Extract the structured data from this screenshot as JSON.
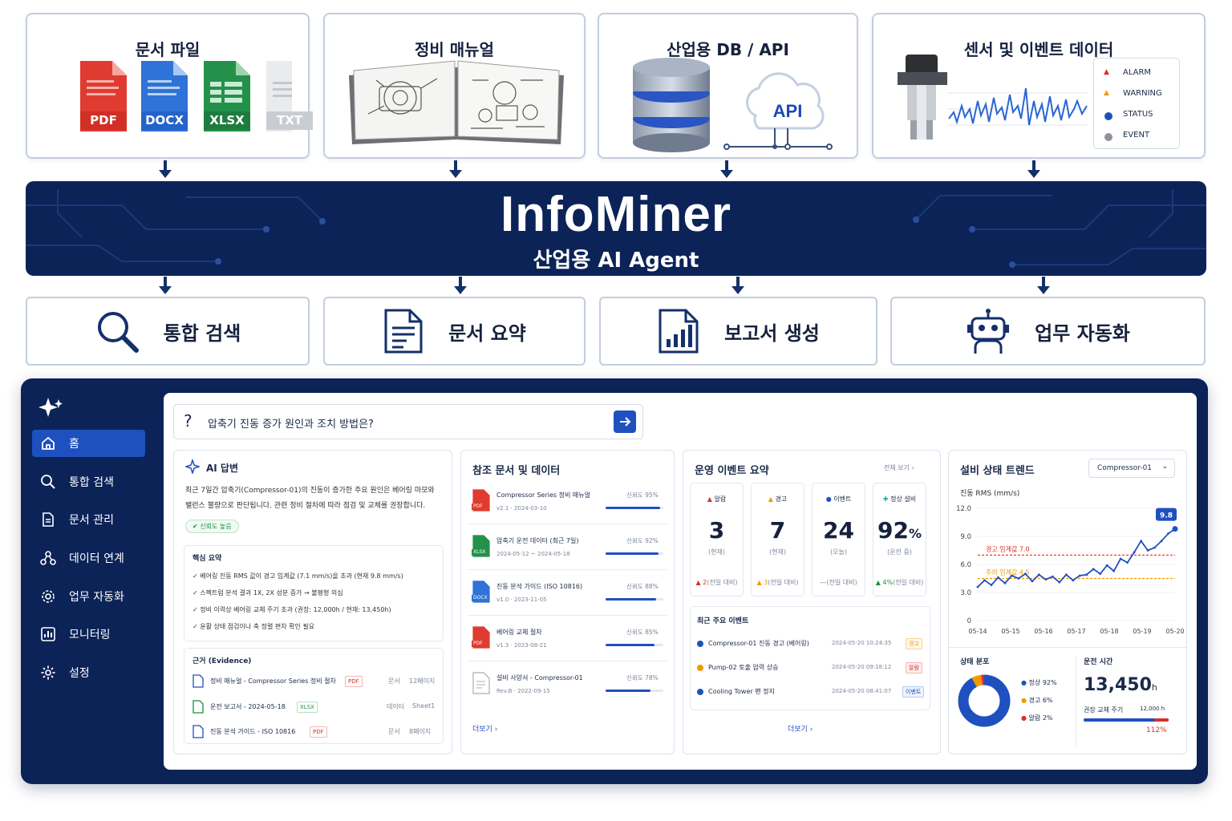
{
  "sources": [
    {
      "title": "문서 파일",
      "files": [
        "PDF",
        "DOCX",
        "XLSX",
        "TXT"
      ]
    },
    {
      "title": "정비 매뉴얼"
    },
    {
      "title": "산업용 DB / API",
      "api_label": "API"
    },
    {
      "title": "센서 및 이벤트 데이터",
      "legend": [
        "ALARM",
        "WARNING",
        "STATUS",
        "EVENT"
      ]
    }
  ],
  "banner": {
    "name": "InfoMiner",
    "subtitle": "산업용 AI Agent"
  },
  "capabilities": [
    {
      "label": "통합 검색",
      "icon": "magnifier-icon"
    },
    {
      "label": "문서 요약",
      "icon": "document-icon"
    },
    {
      "label": "보고서 생성",
      "icon": "report-chart-icon"
    },
    {
      "label": "업무 자동화",
      "icon": "robot-icon"
    }
  ],
  "colors": {
    "navy": "#0c2358",
    "blue": "#1f50c0",
    "red": "#d93025",
    "orange": "#f29900",
    "green": "#1e8e3e"
  },
  "app": {
    "nav": [
      "홈",
      "통합 검색",
      "문서 관리",
      "데이터 연계",
      "업무 자동화",
      "모니터링",
      "설정"
    ],
    "search": {
      "query": "압축기 진동 증가 원인과 조치 방법은?"
    },
    "answer": {
      "title": "AI 답변",
      "text1": "최근 7일간 압축기(Compressor-01)의 진동이 증가한 주요 원인은 베어링 마모와",
      "text2": "밸런스 불량으로 판단됩니다. 관련 정비 절차에 따라 점검 및 교체를 권장합니다.",
      "confidence": "신뢰도 높음",
      "summary_title": "핵심 요약",
      "summary": [
        "베어링 진동 RMS 값이 경고 임계값 (7.1 mm/s)을 초과 (현재 9.8 mm/s)",
        "스펙트럼 분석 결과 1X, 2X 성분 증가 → 불평형 의심",
        "정비 이력상 베어링 교체 주기 초과 (권장: 12,000h / 현재: 13,450h)",
        "윤활 상태 점검이나 축 정렬 편차 확인 필요"
      ],
      "evidence_title": "근거 (Evidence)",
      "evidence": [
        {
          "title": "정비 매뉴얼 - Compressor Series 정비 절차",
          "type": "PDF",
          "kind": "문서",
          "loc": "12페이지"
        },
        {
          "title": "운전 보고서 - 2024-05-18",
          "type": "XLSX",
          "kind": "데이터",
          "loc": "Sheet1"
        },
        {
          "title": "진동 분석 가이드 - ISO 10816",
          "type": "PDF",
          "kind": "문서",
          "loc": "8페이지"
        }
      ]
    },
    "refs": {
      "title": "참조 문서 및 데이터",
      "items": [
        {
          "name": "Compressor Series 정비 매뉴얼",
          "meta": "v2.1 · 2024-03-10",
          "conf": "신뢰도 95%",
          "value": 95,
          "type": "PDF"
        },
        {
          "name": "압축기 운전 데이터 (최근 7일)",
          "meta": "2024-05-12 ~ 2024-05-18",
          "conf": "신뢰도 92%",
          "value": 92,
          "type": "XLSX"
        },
        {
          "name": "진동 분석 가이드 (ISO 10816)",
          "meta": "v1.0 · 2023-11-05",
          "conf": "신뢰도 88%",
          "value": 88,
          "type": "DOCX"
        },
        {
          "name": "베어링 교체 절차",
          "meta": "v1.3 · 2023-08-21",
          "conf": "신뢰도 85%",
          "value": 85,
          "type": "PDF"
        },
        {
          "name": "설비 사양서 - Compressor-01",
          "meta": "Rev.B · 2022-09-15",
          "conf": "신뢰도 78%",
          "value": 78,
          "type": "TXT"
        }
      ],
      "more": "더보기"
    },
    "events": {
      "title": "운영 이벤트 요약",
      "view_all": "전체 보기",
      "stats": [
        {
          "label": "알람",
          "value": "3",
          "unit": "",
          "sub": "(현재)",
          "delta": "▲ 2",
          "delta_note": "(전일 대비)"
        },
        {
          "label": "경고",
          "value": "7",
          "unit": "",
          "sub": "(현재)",
          "delta": "▲ 3",
          "delta_note": "(전일 대비)"
        },
        {
          "label": "이벤트",
          "value": "24",
          "unit": "",
          "sub": "(오늘)",
          "delta": "—",
          "delta_note": "(전일 대비)"
        },
        {
          "label": "정상 설비",
          "value": "92",
          "unit": "%",
          "sub": "(운전 중)",
          "delta": "▲ 4%",
          "delta_note": "(전일 대비)"
        }
      ],
      "recent_title": "최근 주요 이벤트",
      "recent": [
        {
          "text": "Compressor-01 진동 경고 (베어링)",
          "time": "2024-05-20  10:24:35",
          "tag": "경고"
        },
        {
          "text": "Pump-02 토출 압력 상승",
          "time": "2024-05-20  09:18:12",
          "tag": "알람"
        },
        {
          "text": "Cooling Tower 팬 정지",
          "time": "2024-05-20  08:41:07",
          "tag": "이벤트"
        }
      ],
      "more": "더보기"
    },
    "trend": {
      "title": "설비 상태 트렌드",
      "equipment": "Compressor-01",
      "metric": "진동 RMS (mm/s)",
      "warn_label": "경고 임계값  7.0",
      "caution_label": "주의 임계값  4.5",
      "latest": "9.8",
      "dist_title": "상태 분포",
      "dist": [
        {
          "label": "정상",
          "pct": "92%",
          "value": 92
        },
        {
          "label": "경고",
          "pct": "6%",
          "value": 6
        },
        {
          "label": "알람",
          "pct": "2%",
          "value": 2
        }
      ],
      "runtime_title": "운전 시간",
      "runtime_value": "13,450",
      "runtime_unit": "h",
      "replace_label": "권장 교체 주기",
      "replace_value": "12,000 h",
      "ratio": "112%"
    }
  },
  "chart_data": {
    "type": "line",
    "ylabel": "진동 RMS (mm/s)",
    "x_ticks": [
      "05-14",
      "05-15",
      "05-16",
      "05-17",
      "05-18",
      "05-19",
      "05-20"
    ],
    "y_ticks": [
      0,
      3.0,
      6.0,
      9.0,
      12.0
    ],
    "ylim": [
      0,
      12
    ],
    "thresholds": [
      {
        "label": "경고 임계값",
        "value": 7.0
      },
      {
        "label": "주의 임계값",
        "value": 4.5
      }
    ],
    "values": [
      3.6,
      4.3,
      3.8,
      4.6,
      4.0,
      4.8,
      4.5,
      5.0,
      4.2,
      4.9,
      4.4,
      4.7,
      4.1,
      4.9,
      4.3,
      4.8,
      4.9,
      5.5,
      5.0,
      5.9,
      5.3,
      6.6,
      6.2,
      7.3,
      8.5,
      7.5,
      7.8,
      8.5,
      9.3,
      9.8
    ]
  }
}
